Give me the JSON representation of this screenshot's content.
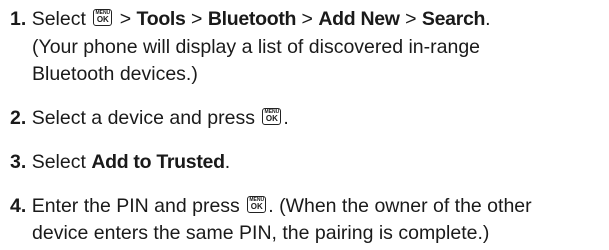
{
  "key_icon": {
    "top": "MENU",
    "bottom": "OK"
  },
  "steps": [
    {
      "number": "1.",
      "t1": "Select",
      "p1": "Tools",
      "p2": "Bluetooth",
      "p3": "Add New",
      "p4": "Search",
      "sep": ">",
      "end": ".",
      "note_line1": "(Your phone will display a list of discovered in-range",
      "note_line2": "Bluetooth devices.)"
    },
    {
      "number": "2.",
      "t1": "Select a device and press",
      "end": "."
    },
    {
      "number": "3.",
      "t1": "Select",
      "bold": "Add to Trusted",
      "end": "."
    },
    {
      "number": "4.",
      "t1": "Enter the PIN and press",
      "t2": ". (When the owner of the other",
      "line2": "device enters the same PIN, the pairing is complete.)"
    }
  ]
}
